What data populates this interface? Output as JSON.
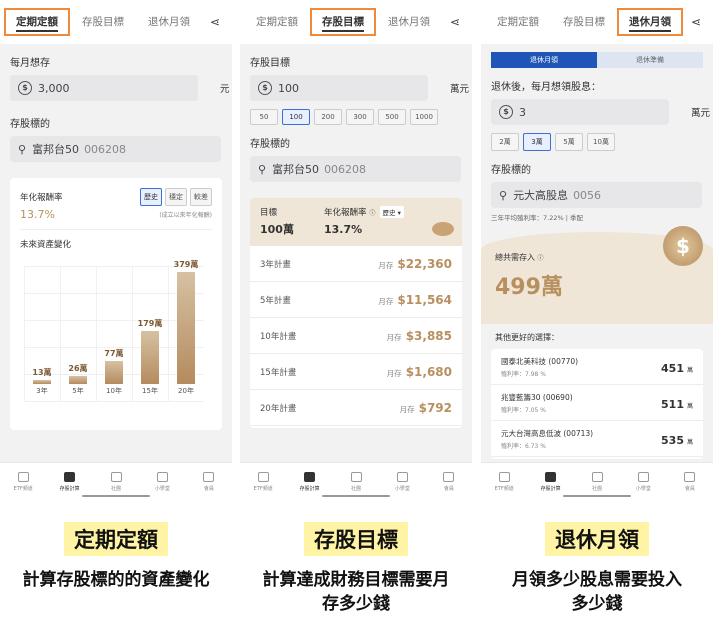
{
  "tabs": [
    "定期定額",
    "存股目標",
    "退休月領"
  ],
  "nav": [
    "ETF頻道",
    "存股計算",
    "社團",
    "小學堂",
    "會員"
  ],
  "p1": {
    "monthly_label": "每月想存",
    "monthly_value": "3,000",
    "unit": "元",
    "stock_label": "存股標的",
    "stock_name": "富邦台50",
    "stock_code": "006208",
    "roi_label": "年化報酬率",
    "roi_value": "13.7%",
    "roi_note": "(成立以來年化報酬)",
    "modes": [
      "歷史",
      "穩定",
      "較差"
    ],
    "growth_title": "未來資產變化"
  },
  "chart_data": {
    "type": "bar",
    "categories": [
      "3年",
      "5年",
      "10年",
      "15年",
      "20年"
    ],
    "values": [
      13,
      26,
      77,
      179,
      379
    ],
    "labels": [
      "13萬",
      "26萬",
      "77萬",
      "179萬",
      "379萬"
    ]
  },
  "p2": {
    "target_label": "存股目標",
    "target_value": "100",
    "unit": "萬元",
    "chips": [
      "50",
      "100",
      "200",
      "300",
      "500",
      "1000"
    ],
    "selected_chip": "100",
    "stock_label": "存股標的",
    "stock_name": "富邦台50",
    "stock_code": "006208",
    "goal_label": "目標",
    "goal_value": "100萬",
    "roi_label": "年化報酬率",
    "roi_mode": "歷史",
    "roi_value": "13.7%",
    "prefix": "月存",
    "plans": [
      {
        "label": "3年計畫",
        "amount": "$22,360"
      },
      {
        "label": "5年計畫",
        "amount": "$11,564"
      },
      {
        "label": "10年計畫",
        "amount": "$3,885"
      },
      {
        "label": "15年計畫",
        "amount": "$1,680"
      },
      {
        "label": "20年計畫",
        "amount": "$792"
      }
    ]
  },
  "p3": {
    "seg": [
      "退休月領",
      "退休準備"
    ],
    "question": "退休後，每月想領股息：",
    "value": "3",
    "unit": "萬元",
    "chips": [
      "2萬",
      "3萬",
      "5萬",
      "10萬"
    ],
    "selected_chip": "3萬",
    "stock_label": "存股標的",
    "stock_name": "元大高股息",
    "stock_code": "0056",
    "avg_note": "三年平均殖利率：7.22% | 季配",
    "need_label": "總共需存入",
    "need_value": "499萬",
    "others_title": "其他更好的選擇：",
    "yield_prefix": "殖利率：",
    "wan": "萬",
    "stocks": [
      {
        "name": "國泰北美科技 (00770)",
        "yield": "7.98 %",
        "amount": "451"
      },
      {
        "name": "兆豐藍籌30 (00690)",
        "yield": "7.05 %",
        "amount": "511"
      },
      {
        "name": "元大台灣高息低波 (00713)",
        "yield": "6.73 %",
        "amount": "535"
      }
    ]
  },
  "captions": [
    {
      "title": "定期定額",
      "sub": "計算存股標的的資產變化"
    },
    {
      "title": "存股目標",
      "sub": "計算達成財務目標需要月存多少錢"
    },
    {
      "title": "退休月領",
      "sub": "月領多少股息需要投入多少錢"
    }
  ],
  "colors": {
    "accent": "#ef8a3c",
    "gold": "#b8905f",
    "blue": "#1f55b7",
    "highlight": "#fff3a6"
  }
}
